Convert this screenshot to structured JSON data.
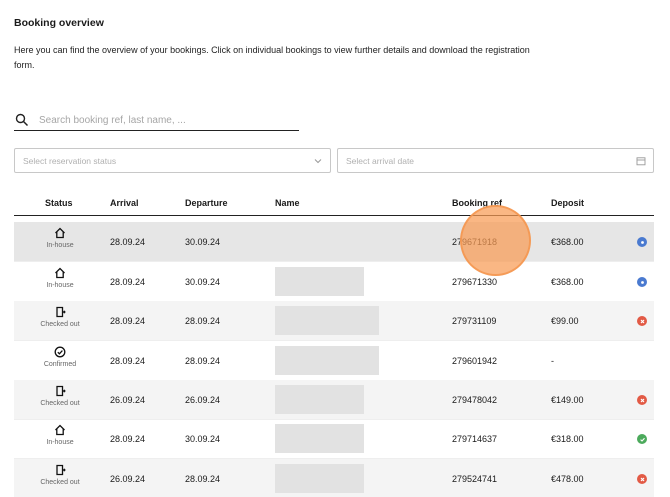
{
  "header": {
    "title": "Booking overview",
    "description": "Here you can find the overview of your bookings. Click on individual bookings to view further details and download the registration form."
  },
  "search": {
    "placeholder": "Search booking ref, last name, ..."
  },
  "filters": {
    "status_placeholder": "Select reservation status",
    "date_placeholder": "Select arrival date"
  },
  "table": {
    "columns": {
      "status": "Status",
      "arrival": "Arrival",
      "departure": "Departure",
      "name": "Name",
      "booking_ref": "Booking ref",
      "deposit": "Deposit"
    },
    "rows": [
      {
        "status": "In-house",
        "status_icon": "house-icon",
        "arrival": "28.09.24",
        "departure": "30.09.24",
        "booking_ref": "279671918",
        "deposit": "€368.00",
        "indicator": "blue"
      },
      {
        "status": "In-house",
        "status_icon": "house-icon",
        "arrival": "28.09.24",
        "departure": "30.09.24",
        "booking_ref": "279671330",
        "deposit": "€368.00",
        "indicator": "blue"
      },
      {
        "status": "Checked out",
        "status_icon": "door-exit-icon",
        "arrival": "28.09.24",
        "departure": "28.09.24",
        "booking_ref": "279731109",
        "deposit": "€99.00",
        "indicator": "red"
      },
      {
        "status": "Confirmed",
        "status_icon": "check-circle-icon",
        "arrival": "28.09.24",
        "departure": "28.09.24",
        "booking_ref": "279601942",
        "deposit": "-",
        "indicator": "none"
      },
      {
        "status": "Checked out",
        "status_icon": "door-exit-icon",
        "arrival": "26.09.24",
        "departure": "26.09.24",
        "booking_ref": "279478042",
        "deposit": "€149.00",
        "indicator": "red"
      },
      {
        "status": "In-house",
        "status_icon": "house-icon",
        "arrival": "28.09.24",
        "departure": "30.09.24",
        "booking_ref": "279714637",
        "deposit": "€318.00",
        "indicator": "green"
      },
      {
        "status": "Checked out",
        "status_icon": "door-exit-icon",
        "arrival": "26.09.24",
        "departure": "28.09.24",
        "booking_ref": "279524741",
        "deposit": "€478.00",
        "indicator": "red"
      }
    ]
  },
  "colors": {
    "blue": "#4a7ad0",
    "red": "#e25a45",
    "green": "#4caa5c",
    "cursor": "#f89b55"
  }
}
